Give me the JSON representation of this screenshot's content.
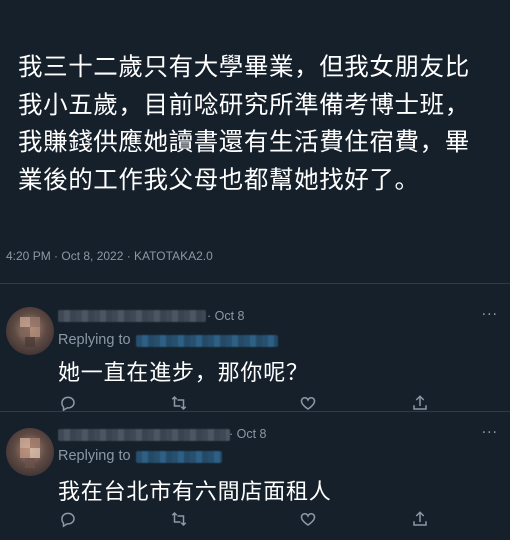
{
  "tweet": {
    "text": "我三十二歲只有大學畢業，但我女朋友比\n我小五歲，目前唸研究所準備考博士班，\n我賺錢供應她讀書還有生活費住宿費，畢\n業後的工作我父母也都幫她找好了。",
    "meta": "4:20 PM · Oct 8, 2022 · KATOTAKA2.0"
  },
  "replies": [
    {
      "date": "· Oct 8",
      "replying_label": "Replying to",
      "text": "她一直在進步，那你呢？",
      "more": "···"
    },
    {
      "date": "· Oct 8",
      "replying_label": "Replying to",
      "text": "我在台北市有六間店面租人",
      "more": "···"
    }
  ],
  "icons": {
    "reply": "comment-icon",
    "retweet": "retweet-icon",
    "like": "heart-icon",
    "share": "share-icon"
  },
  "colors": {
    "background": "#15202b",
    "secondary_text": "#8b98a5",
    "divider": "#2f3b47"
  }
}
